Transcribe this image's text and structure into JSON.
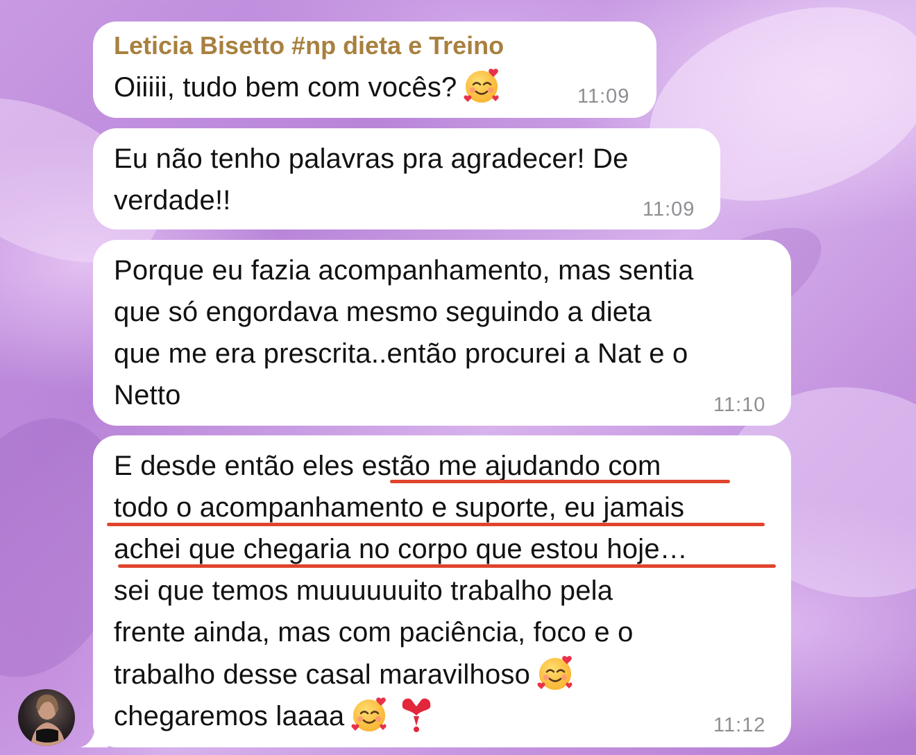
{
  "chat": {
    "messages": [
      {
        "sender": "Leticia Bisetto #np dieta e Treino",
        "lines": [
          "Oiiiii, tudo bem com vocês?"
        ],
        "emojis": [
          "smiling-face-with-hearts"
        ],
        "time": "11:09"
      },
      {
        "lines": [
          "Eu não tenho palavras pra agradecer! De",
          "verdade!!"
        ],
        "time": "11:09"
      },
      {
        "lines": [
          "Porque eu fazia acompanhamento, mas sentia",
          "que só engordava mesmo seguindo a dieta",
          "que me era prescrita..então procurei a Nat e o",
          "Netto"
        ],
        "time": "11:10"
      },
      {
        "lines": [
          "E desde então eles estão me ajudando com",
          "todo o acompanhamento e suporte, eu jamais",
          "achei que chegaria no corpo que estou hoje…",
          "sei que temos muuuuuuito trabalho pela",
          "frente ainda, mas com paciência, foco e o",
          "trabalho desse casal maravilhoso",
          "chegaremos laaaa"
        ],
        "emojis": [
          "smiling-face-with-hearts",
          "smiling-face-with-hearts",
          "red-heart-exclamation"
        ],
        "highlight_color": "#e0442c",
        "time": "11:12"
      }
    ]
  },
  "colors": {
    "sender_name": "#a8803f",
    "bubble": "#ffffff",
    "timestamp": "#8e8e93",
    "underline": "#e0442c"
  }
}
